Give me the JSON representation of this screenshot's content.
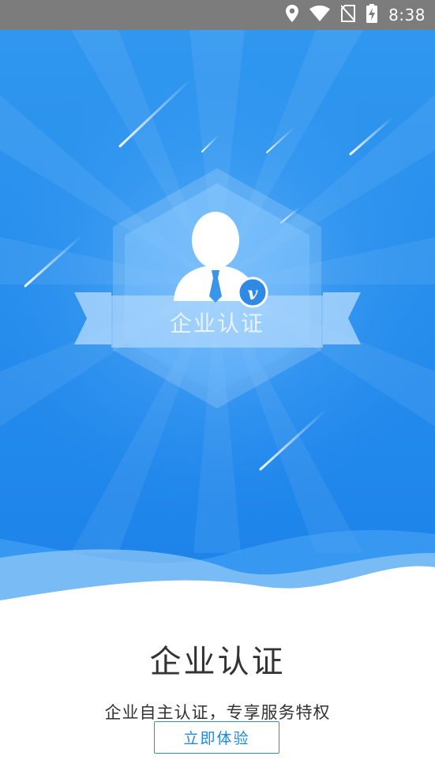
{
  "status_bar": {
    "time": "8:38",
    "icons": [
      "location-icon",
      "wifi-icon",
      "no-sim-icon",
      "battery-charging-icon"
    ]
  },
  "hero": {
    "badge_label": "企业认证",
    "badge_icon": "verified-v-icon",
    "avatar_icon": "business-person-icon"
  },
  "main": {
    "title": "企业认证",
    "subtitle": "企业自主认证，专享服务特权",
    "cta_label": "立即体验"
  },
  "colors": {
    "primary": "#1e88e5",
    "gradient_top": "#2d94ee",
    "gradient_bottom": "#1a7fe8",
    "text": "#333333",
    "status_bar": "#7c7c7c"
  }
}
